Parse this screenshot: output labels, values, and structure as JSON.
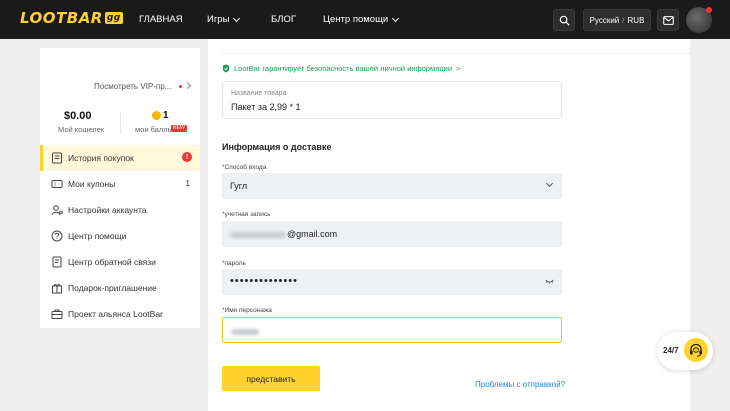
{
  "header": {
    "logo": "LOOTBAR",
    "logo_badge": "gg",
    "nav": [
      "ГЛАВНАЯ",
      "Игры",
      "БЛОГ",
      "Центр помощи"
    ],
    "language": "Русский",
    "currency": "RUB",
    "icons": [
      "search-icon",
      "mail-icon"
    ]
  },
  "sidebar": {
    "vip_link": "Посмотреть VIP-пр...",
    "wallet_value": "$0.00",
    "wallet_label": "Мой кошелек",
    "points_value": "1",
    "points_label": "мои баллы",
    "points_badge": "NEW",
    "items": [
      {
        "label": "История покупок",
        "icon": "receipt-icon",
        "active": true,
        "alert": "!"
      },
      {
        "label": "Мои купоны",
        "icon": "coupon-icon",
        "count": "1"
      },
      {
        "label": "Настройки аккаунта",
        "icon": "user-settings-icon"
      },
      {
        "label": "Центр помощи",
        "icon": "help-icon"
      },
      {
        "label": "Центр обратной связи",
        "icon": "feedback-icon"
      },
      {
        "label": "Подарок-приглашение",
        "icon": "gift-icon"
      },
      {
        "label": "Проект альянса LootBar",
        "icon": "alliance-icon"
      }
    ]
  },
  "main": {
    "guarantee": "LootBar гарантирует безопасность вашей личной информации",
    "product_label": "Название товара",
    "product_value": "Пакет за 2,99 * 1",
    "section_title": "Информация о доставке",
    "login_method_label": "*Способ входа",
    "login_method_value": "Гугл",
    "account_label": "*учетная запись",
    "account_value_suffix": "@gmail.com",
    "password_label": "*пароль",
    "password_value": "••••••••••••••",
    "character_label": "*Имя персонажа",
    "submit_label": "представить",
    "problems_link": "Проблемы с отправкой?"
  },
  "support": {
    "label": "24/7"
  },
  "colors": {
    "accent": "#ffd22e",
    "topbar": "#1a1a1a",
    "success": "#18a058",
    "link": "#1e88e5",
    "alert": "#e53935"
  }
}
